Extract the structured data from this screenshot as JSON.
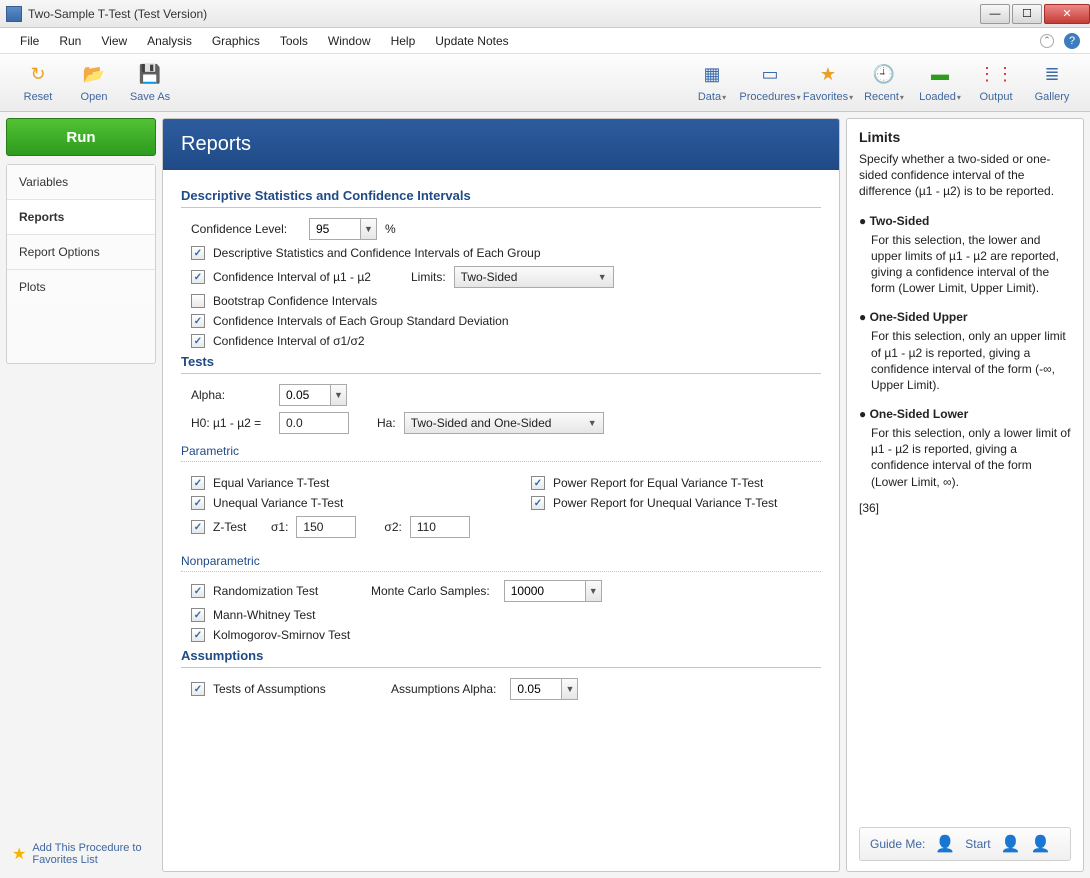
{
  "window": {
    "title": "Two-Sample T-Test (Test Version)"
  },
  "menu": [
    "File",
    "Run",
    "View",
    "Analysis",
    "Graphics",
    "Tools",
    "Window",
    "Help",
    "Update Notes"
  ],
  "toolbar_left": [
    {
      "label": "Reset",
      "icon": "↻"
    },
    {
      "label": "Open",
      "icon": "📂"
    },
    {
      "label": "Save As",
      "icon": "💾"
    }
  ],
  "toolbar_right": [
    {
      "label": "Data",
      "icon": "▦",
      "dd": true
    },
    {
      "label": "Procedures",
      "icon": "▭",
      "dd": true
    },
    {
      "label": "Favorites",
      "icon": "★",
      "dd": true
    },
    {
      "label": "Recent",
      "icon": "🕘",
      "dd": true
    },
    {
      "label": "Loaded",
      "icon": "▬",
      "dd": true
    },
    {
      "label": "Output",
      "icon": "⋮⋮"
    },
    {
      "label": "Gallery",
      "icon": "≣"
    }
  ],
  "run_label": "Run",
  "side_tabs": [
    "Variables",
    "Reports",
    "Report Options",
    "Plots"
  ],
  "active_tab": "Reports",
  "fav_link": "Add This Procedure to Favorites List",
  "panel_title": "Reports",
  "sections": {
    "desc": {
      "title": "Descriptive Statistics and Confidence Intervals",
      "conf_level_label": "Confidence Level:",
      "conf_level_value": "95",
      "conf_level_suffix": "%",
      "cb1": "Descriptive Statistics and Confidence Intervals of Each Group",
      "cb2": "Confidence Interval of µ1 - µ2",
      "limits_label": "Limits:",
      "limits_value": "Two-Sided",
      "cb3": "Bootstrap Confidence Intervals",
      "cb4": "Confidence Intervals of Each Group Standard Deviation",
      "cb5": "Confidence Interval of σ1/σ2"
    },
    "tests": {
      "title": "Tests",
      "alpha_label": "Alpha:",
      "alpha_value": "0.05",
      "h0_label": "H0: µ1 - µ2 =",
      "h0_value": "0.0",
      "ha_label": "Ha:",
      "ha_value": "Two-Sided and One-Sided",
      "parametric_title": "Parametric",
      "p_cb1": "Equal Variance T-Test",
      "p_cb2": "Unequal Variance T-Test",
      "p_cb3": "Z-Test",
      "sigma1_label": "σ1:",
      "sigma1_value": "150",
      "sigma2_label": "σ2:",
      "sigma2_value": "110",
      "p_cb4": "Power Report for Equal Variance T-Test",
      "p_cb5": "Power Report for Unequal Variance T-Test",
      "nonparametric_title": "Nonparametric",
      "np_cb1": "Randomization Test",
      "mc_label": "Monte Carlo Samples:",
      "mc_value": "10000",
      "np_cb2": "Mann-Whitney Test",
      "np_cb3": "Kolmogorov-Smirnov Test"
    },
    "assumptions": {
      "title": "Assumptions",
      "cb1": "Tests of Assumptions",
      "alpha_label": "Assumptions Alpha:",
      "alpha_value": "0.05"
    }
  },
  "help": {
    "title": "Limits",
    "intro": "Specify whether a two-sided or one-sided confidence interval of the difference (µ1 - µ2) is to be reported.",
    "b1_head": "● Two-Sided",
    "b1_body": "For this selection, the lower and upper limits of µ1 - µ2 are reported, giving a confidence interval of the form (Lower Limit, Upper Limit).",
    "b2_head": "● One-Sided Upper",
    "b2_body": "For this selection, only an upper limit of µ1 - µ2 is reported, giving a confidence interval of the form (-∞, Upper Limit).",
    "b3_head": "● One-Sided Lower",
    "b3_body": "For this selection, only a lower limit of µ1 - µ2 is reported, giving a confidence interval of the form (Lower Limit, ∞).",
    "ref": "[36]",
    "guide_label": "Guide Me:",
    "guide_start": "Start"
  }
}
